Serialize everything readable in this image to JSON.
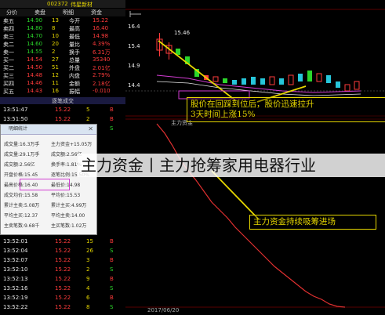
{
  "stock": {
    "code": "002372",
    "name": "伟星新材"
  },
  "tabs": [
    "分价",
    "卖盘",
    "明细",
    "资金"
  ],
  "quote_rows": [
    {
      "a": "卖五",
      "b": "14.90",
      "c": "13",
      "d": "今开",
      "e": "15.22"
    },
    {
      "a": "卖四",
      "b": "14.80",
      "c": "8",
      "d": "最高",
      "e": "16.40"
    },
    {
      "a": "卖三",
      "b": "14.70",
      "c": "10",
      "d": "最低",
      "e": "14.98"
    },
    {
      "a": "卖二",
      "b": "14.60",
      "c": "20",
      "d": "量比",
      "e": "4.39%"
    },
    {
      "a": "卖一",
      "b": "14.55",
      "c": "2",
      "d": "换手",
      "e": "6.31万"
    },
    {
      "a": "买一",
      "b": "14.54",
      "c": "27",
      "d": "总量",
      "e": "35340"
    },
    {
      "a": "买二",
      "b": "14.50",
      "c": "51",
      "d": "外盘",
      "e": "2.01亿"
    },
    {
      "a": "买三",
      "b": "14.48",
      "c": "12",
      "d": "内盘",
      "e": "2.79%"
    },
    {
      "a": "买四",
      "b": "14.46",
      "c": "11",
      "d": "金额",
      "e": "2.18亿"
    },
    {
      "a": "买五",
      "b": "14.43",
      "c": "16",
      "d": "振幅",
      "e": "-0.010"
    }
  ],
  "tick_header": "逐笔成交",
  "ticks_top": [
    {
      "t": "13:51:47",
      "p": "15.22",
      "v": "5",
      "f": "B"
    },
    {
      "t": "13:51:50",
      "p": "15.22",
      "v": "2",
      "f": "B"
    },
    {
      "t": "13:51:53",
      "p": "15.22",
      "v": "7",
      "f": "S"
    }
  ],
  "dialog": {
    "title": "明细统计",
    "rows": [
      {
        "l": "主力资金+15.05万",
        "r": "成交量:16.3万手"
      },
      {
        "l": "成交额:2.56亿",
        "r": "成交量:29.1万手"
      },
      {
        "l": "换手率:1.81%",
        "r": "成交额:2.56亿"
      },
      {
        "l": "逐笔比例:15.50%",
        "r": "开盘价格:15.45"
      },
      {
        "l": "最低价:14.98",
        "r": "最高价格:16.40"
      },
      {
        "l": "平均价:15.53",
        "r": "成交均价:15.58"
      },
      {
        "l": "累计主买:4.99万",
        "r": "累计主卖:5.08万"
      },
      {
        "l": "平均主卖:14.00",
        "r": "平均主买:12.37"
      },
      {
        "l": "主买笔数:1.02万",
        "r": "主卖笔数:9.68千"
      }
    ]
  },
  "ticks_bottom": [
    {
      "t": "13:52:01",
      "p": "15.22",
      "v": "15",
      "f": "B"
    },
    {
      "t": "13:52:04",
      "p": "15.22",
      "v": "26",
      "f": "S"
    },
    {
      "t": "13:52:07",
      "p": "15.22",
      "v": "3",
      "f": "B"
    },
    {
      "t": "13:52:10",
      "p": "15.22",
      "v": "2",
      "f": "S"
    },
    {
      "t": "13:52:13",
      "p": "15.22",
      "v": "9",
      "f": "B"
    },
    {
      "t": "13:52:16",
      "p": "15.22",
      "v": "4",
      "f": "S"
    },
    {
      "t": "13:52:19",
      "p": "15.22",
      "v": "6",
      "f": "B"
    },
    {
      "t": "13:52:22",
      "p": "15.22",
      "v": "8",
      "f": "S"
    }
  ],
  "chart": {
    "ticks_left_top": [
      "16.4",
      "15.4",
      "14.9",
      "14.4"
    ],
    "price_marker": "15.46",
    "lower_panel_label": "主力资金",
    "bottom_date": "2017/06/20"
  },
  "callouts": {
    "top": [
      "股价在回踩到位后，股价迅速拉升",
      "3天时间上涨15%"
    ],
    "bottom": "主力资金持续吸筹进场"
  },
  "banner": "主力资金丨主力抢筹家用电器行业",
  "colors": {
    "up": "#ff3b3b",
    "down": "#2bd62b",
    "accent": "#e6d600",
    "highlight": "#d23cd2"
  }
}
